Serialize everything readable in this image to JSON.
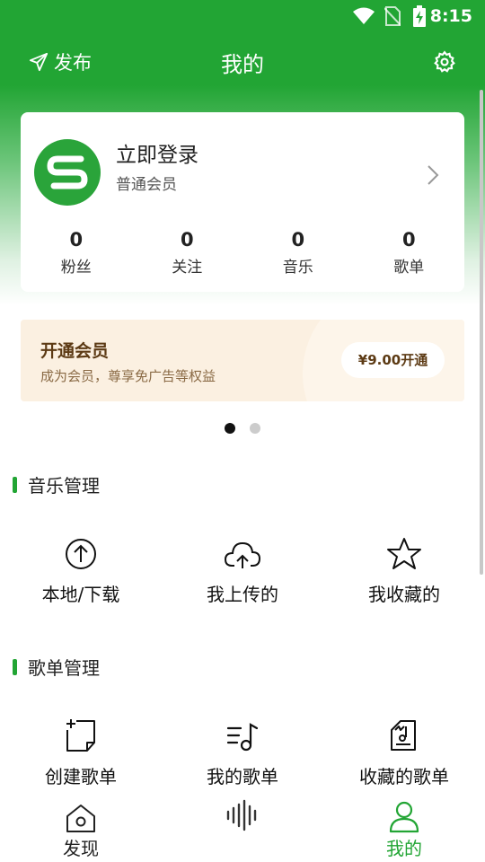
{
  "status_bar": {
    "time": "8:15"
  },
  "header": {
    "publish_label": "发布",
    "title": "我的"
  },
  "profile": {
    "name": "立即登录",
    "level": "普通会员",
    "stats": [
      {
        "value": "0",
        "label": "粉丝"
      },
      {
        "value": "0",
        "label": "关注"
      },
      {
        "value": "0",
        "label": "音乐"
      },
      {
        "value": "0",
        "label": "歌单"
      }
    ]
  },
  "vip_banner": {
    "title": "开通会员",
    "subtitle": "成为会员，尊享免广告等权益",
    "button": "¥9.00开通"
  },
  "carousel": {
    "pages": 2,
    "active": 1
  },
  "music_section": {
    "title": "音乐管理",
    "items": [
      {
        "label": "本地/下载",
        "icon": "upload-circle-icon"
      },
      {
        "label": "我上传的",
        "icon": "cloud-upload-icon"
      },
      {
        "label": "我收藏的",
        "icon": "star-icon"
      }
    ]
  },
  "playlist_section": {
    "title": "歌单管理",
    "items": [
      {
        "label": "创建歌单",
        "icon": "create-playlist-icon"
      },
      {
        "label": "我的歌单",
        "icon": "playlist-icon"
      },
      {
        "label": "收藏的歌单",
        "icon": "collected-playlist-icon"
      }
    ]
  },
  "tabbar": {
    "tabs": [
      {
        "label": "发现",
        "icon": "home-icon",
        "active": false
      },
      {
        "label": "",
        "icon": "waveform-icon",
        "active": false
      },
      {
        "label": "我的",
        "icon": "person-icon",
        "active": true
      }
    ]
  },
  "colors": {
    "brand": "#22a534",
    "vip_bg": "#fbf0e1",
    "vip_text": "#5c3a14"
  }
}
